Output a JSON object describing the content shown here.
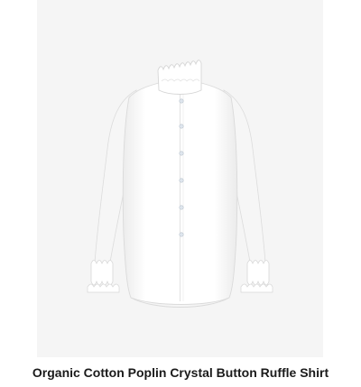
{
  "product": {
    "title": "Organic Cotton Poplin Crystal Button Ruffle Shirt",
    "image_icon": "white-ruffle-collar-shirt",
    "colors": {
      "image_background": "#f5f5f5",
      "shirt": "#ffffff",
      "title_text": "#1a1a1a"
    }
  }
}
